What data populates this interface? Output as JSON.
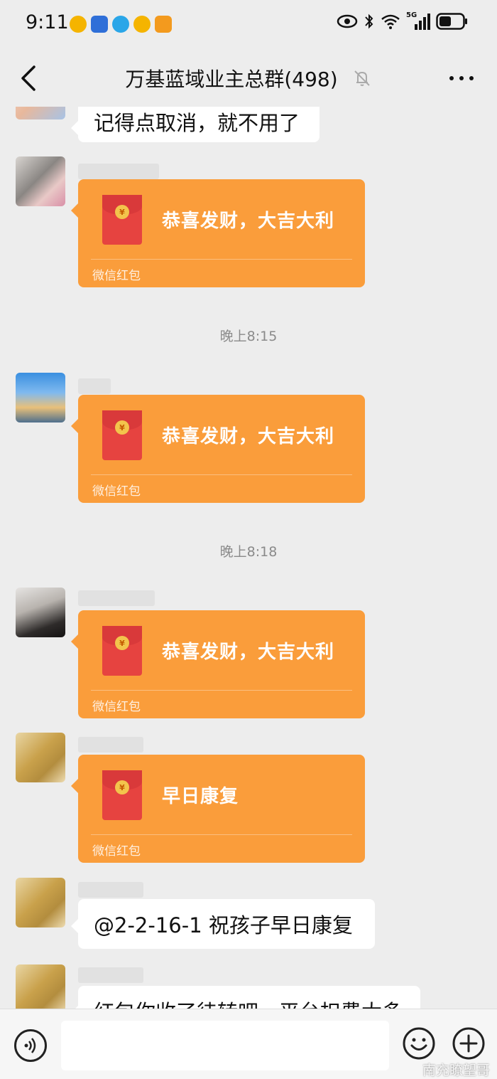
{
  "status_bar": {
    "time": "9:11",
    "network": "5G"
  },
  "header": {
    "title": "万基蓝域业主总群(498)"
  },
  "messages": {
    "msg0": {
      "text": "记得点取消，就不用了"
    },
    "rp1": {
      "title": "恭喜发财，大吉大利",
      "footer": "微信红包"
    },
    "ts1": "晚上8:15",
    "rp2": {
      "title": "恭喜发财，大吉大利",
      "footer": "微信红包"
    },
    "ts2": "晚上8:18",
    "rp3": {
      "title": "恭喜发财，大吉大利",
      "footer": "微信红包"
    },
    "rp4": {
      "title": "早日康复",
      "footer": "微信红包"
    },
    "msg5": {
      "text": "@2-2-16-1  祝孩子早日康复"
    },
    "msg6": {
      "text": "红包你收了待转吧，平台扣费太多"
    }
  },
  "input": {
    "value": ""
  },
  "watermark": "南充瞭望哥",
  "colors": {
    "redpacket": "#fa9d3b",
    "background": "#ededed",
    "bubble": "#ffffff"
  }
}
